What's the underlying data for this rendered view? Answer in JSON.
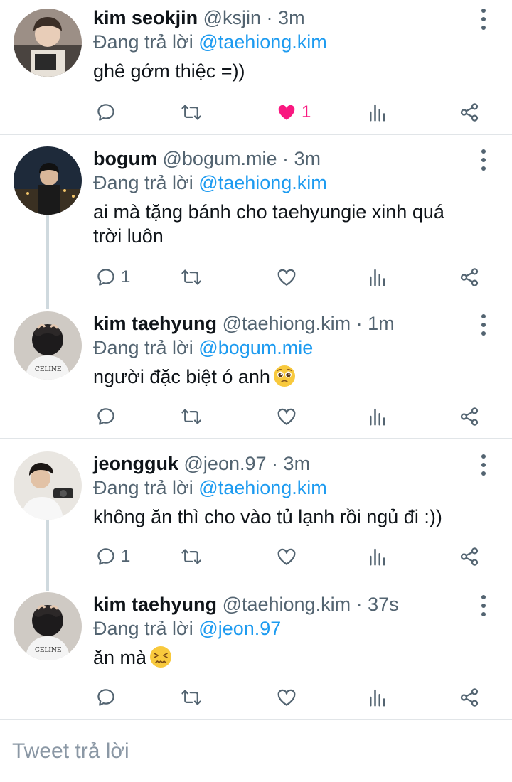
{
  "replying_prefix": "Đang trả lời",
  "dot": "·",
  "reply_placeholder": "Tweet trả lời",
  "colors": {
    "accent": "#1d9bf0",
    "like": "#f91880",
    "secondary": "#536471"
  },
  "icons": [
    "reply-icon",
    "retweet-icon",
    "like-icon",
    "analytics-icon",
    "share-icon",
    "more-icon"
  ],
  "tweets": [
    {
      "name": "kim seokjin",
      "handle": "@ksjin",
      "time": "3m",
      "replying_to": "@taehiong.kim",
      "text": "ghê gớm thiệc =))",
      "reply_count": "",
      "like_count": "1",
      "liked": true
    },
    {
      "name": "bogum",
      "handle": "@bogum.mie",
      "time": "3m",
      "replying_to": "@taehiong.kim",
      "text": "ai mà tặng bánh cho taehyungie xinh quá trời luôn",
      "reply_count": "1",
      "like_count": "",
      "liked": false
    },
    {
      "name": "kim taehyung",
      "handle": "@taehiong.kim",
      "time": "1m",
      "replying_to": "@bogum.mie",
      "text": "người đặc biệt ó anh",
      "emoji": "pleading-face",
      "reply_count": "",
      "like_count": "",
      "liked": false
    },
    {
      "name": "jeongguk",
      "handle": "@jeon.97",
      "time": "3m",
      "replying_to": "@taehiong.kim",
      "text": "không ăn thì cho vào tủ lạnh rồi ngủ đi :))",
      "reply_count": "1",
      "like_count": "",
      "liked": false
    },
    {
      "name": "kim taehyung",
      "handle": "@taehiong.kim",
      "time": "37s",
      "replying_to": "@jeon.97",
      "text": "ăn mà",
      "emoji": "confounded-face",
      "reply_count": "",
      "like_count": "",
      "liked": false
    }
  ]
}
